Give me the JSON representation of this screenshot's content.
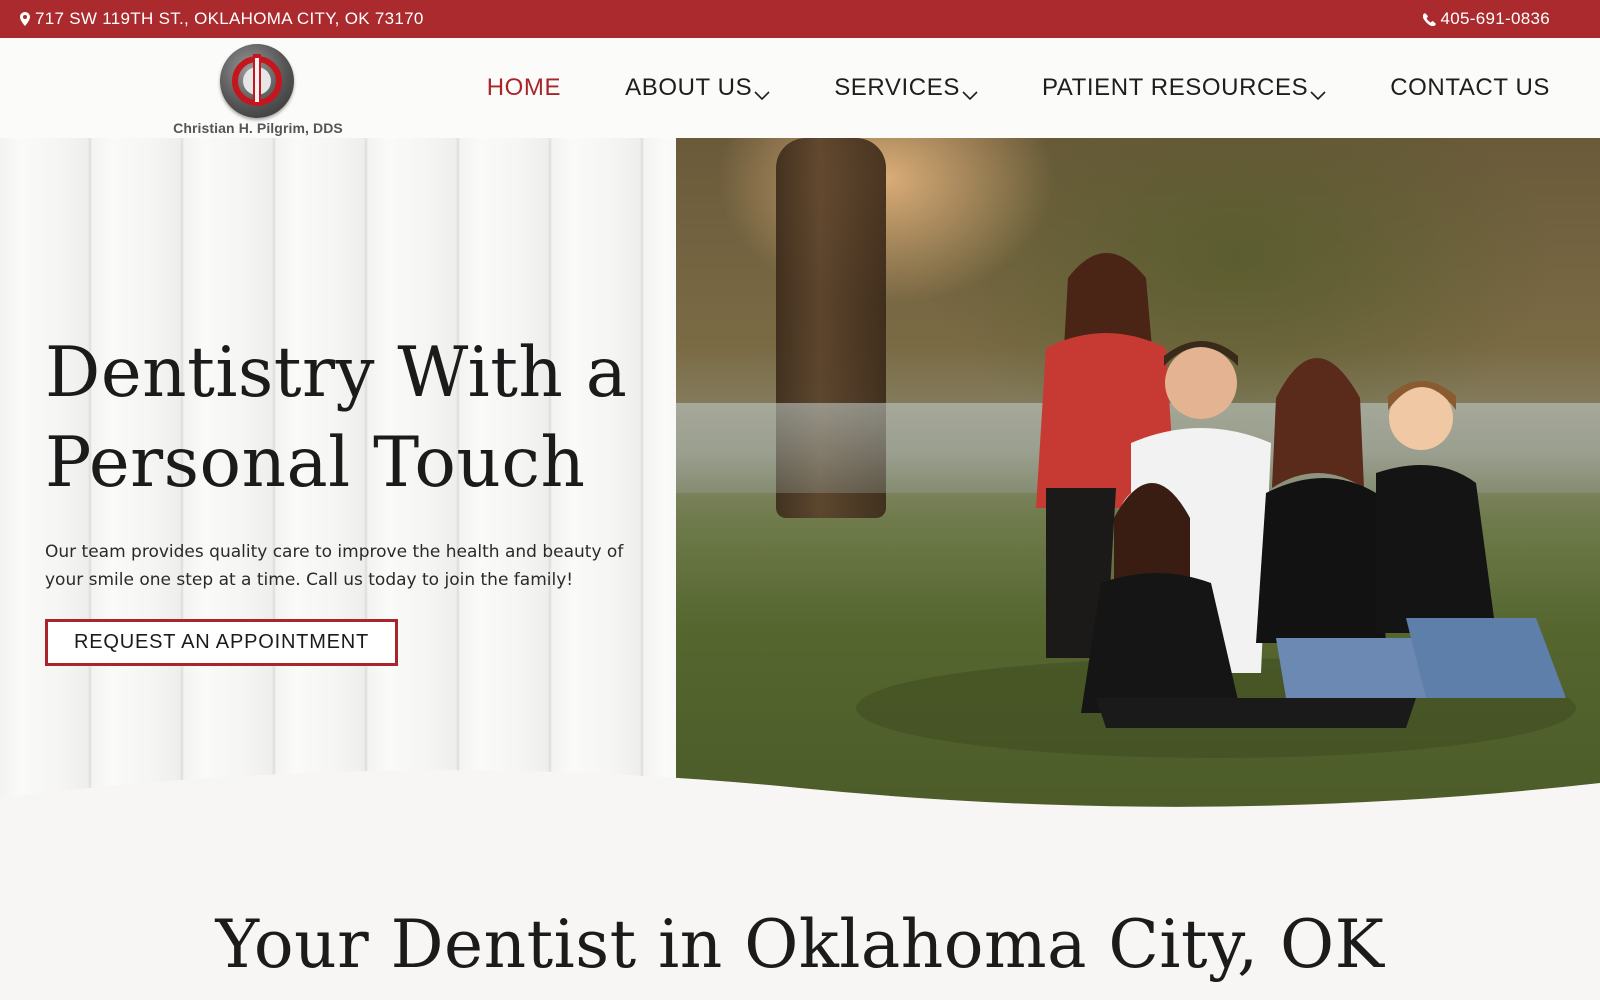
{
  "topbar": {
    "address": "717 SW 119TH ST., OKLAHOMA CITY, OK 73170",
    "phone": "405-691-0836",
    "address_icon": "map-pin-icon",
    "phone_icon": "phone-icon"
  },
  "logo": {
    "text": "Christian H. Pilgrim, DDS"
  },
  "nav": {
    "items": [
      {
        "label": "HOME",
        "active": true,
        "dropdown": false
      },
      {
        "label": "ABOUT US",
        "active": false,
        "dropdown": true
      },
      {
        "label": "SERVICES",
        "active": false,
        "dropdown": true
      },
      {
        "label": "PATIENT RESOURCES",
        "active": false,
        "dropdown": true
      },
      {
        "label": "CONTACT US",
        "active": false,
        "dropdown": false
      }
    ]
  },
  "hero": {
    "title_line1": "Dentistry With a",
    "title_line2": "Personal Touch",
    "description": "Our team provides quality care to improve the health and beauty of your smile one step at a time. Call us today to join the family!",
    "cta_label": "REQUEST AN APPOINTMENT"
  },
  "intro": {
    "title": "Your Dentist in Oklahoma City, OK"
  },
  "colors": {
    "brand_red": "#ab2a2e",
    "active_nav": "#a8262b",
    "text_dark": "#1b1b1b"
  }
}
